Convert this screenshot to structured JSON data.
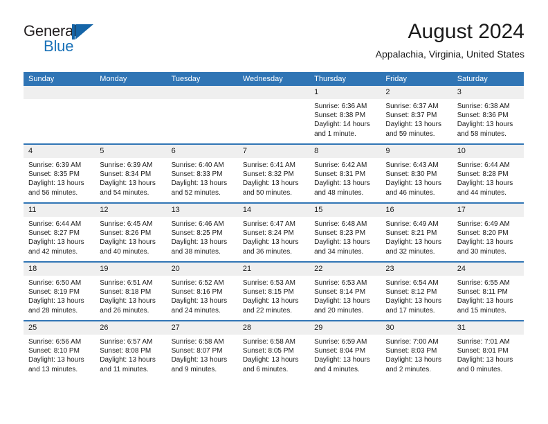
{
  "brand": {
    "word_one": "General",
    "word_two": "Blue",
    "mark": "triangle-logo"
  },
  "header": {
    "title": "August 2024",
    "subtitle": "Appalachia, Virginia, United States"
  },
  "colors": {
    "header_blue": "#3075b5",
    "brand_blue": "#1565a8",
    "daynum_band": "#efefef",
    "text": "#1a1a1a"
  },
  "weekday_headers": [
    "Sunday",
    "Monday",
    "Tuesday",
    "Wednesday",
    "Thursday",
    "Friday",
    "Saturday"
  ],
  "labels": {
    "sunrise": "Sunrise:",
    "sunset": "Sunset:",
    "daylight": "Daylight:"
  },
  "weeks": [
    [
      {
        "day": "",
        "sunrise": "",
        "sunset": "",
        "daylight": "",
        "empty": true
      },
      {
        "day": "",
        "sunrise": "",
        "sunset": "",
        "daylight": "",
        "empty": true
      },
      {
        "day": "",
        "sunrise": "",
        "sunset": "",
        "daylight": "",
        "empty": true
      },
      {
        "day": "",
        "sunrise": "",
        "sunset": "",
        "daylight": "",
        "empty": true
      },
      {
        "day": "1",
        "sunrise": "Sunrise: 6:36 AM",
        "sunset": "Sunset: 8:38 PM",
        "daylight": "Daylight: 14 hours and 1 minute."
      },
      {
        "day": "2",
        "sunrise": "Sunrise: 6:37 AM",
        "sunset": "Sunset: 8:37 PM",
        "daylight": "Daylight: 13 hours and 59 minutes."
      },
      {
        "day": "3",
        "sunrise": "Sunrise: 6:38 AM",
        "sunset": "Sunset: 8:36 PM",
        "daylight": "Daylight: 13 hours and 58 minutes."
      }
    ],
    [
      {
        "day": "4",
        "sunrise": "Sunrise: 6:39 AM",
        "sunset": "Sunset: 8:35 PM",
        "daylight": "Daylight: 13 hours and 56 minutes."
      },
      {
        "day": "5",
        "sunrise": "Sunrise: 6:39 AM",
        "sunset": "Sunset: 8:34 PM",
        "daylight": "Daylight: 13 hours and 54 minutes."
      },
      {
        "day": "6",
        "sunrise": "Sunrise: 6:40 AM",
        "sunset": "Sunset: 8:33 PM",
        "daylight": "Daylight: 13 hours and 52 minutes."
      },
      {
        "day": "7",
        "sunrise": "Sunrise: 6:41 AM",
        "sunset": "Sunset: 8:32 PM",
        "daylight": "Daylight: 13 hours and 50 minutes."
      },
      {
        "day": "8",
        "sunrise": "Sunrise: 6:42 AM",
        "sunset": "Sunset: 8:31 PM",
        "daylight": "Daylight: 13 hours and 48 minutes."
      },
      {
        "day": "9",
        "sunrise": "Sunrise: 6:43 AM",
        "sunset": "Sunset: 8:30 PM",
        "daylight": "Daylight: 13 hours and 46 minutes."
      },
      {
        "day": "10",
        "sunrise": "Sunrise: 6:44 AM",
        "sunset": "Sunset: 8:28 PM",
        "daylight": "Daylight: 13 hours and 44 minutes."
      }
    ],
    [
      {
        "day": "11",
        "sunrise": "Sunrise: 6:44 AM",
        "sunset": "Sunset: 8:27 PM",
        "daylight": "Daylight: 13 hours and 42 minutes."
      },
      {
        "day": "12",
        "sunrise": "Sunrise: 6:45 AM",
        "sunset": "Sunset: 8:26 PM",
        "daylight": "Daylight: 13 hours and 40 minutes."
      },
      {
        "day": "13",
        "sunrise": "Sunrise: 6:46 AM",
        "sunset": "Sunset: 8:25 PM",
        "daylight": "Daylight: 13 hours and 38 minutes."
      },
      {
        "day": "14",
        "sunrise": "Sunrise: 6:47 AM",
        "sunset": "Sunset: 8:24 PM",
        "daylight": "Daylight: 13 hours and 36 minutes."
      },
      {
        "day": "15",
        "sunrise": "Sunrise: 6:48 AM",
        "sunset": "Sunset: 8:23 PM",
        "daylight": "Daylight: 13 hours and 34 minutes."
      },
      {
        "day": "16",
        "sunrise": "Sunrise: 6:49 AM",
        "sunset": "Sunset: 8:21 PM",
        "daylight": "Daylight: 13 hours and 32 minutes."
      },
      {
        "day": "17",
        "sunrise": "Sunrise: 6:49 AM",
        "sunset": "Sunset: 8:20 PM",
        "daylight": "Daylight: 13 hours and 30 minutes."
      }
    ],
    [
      {
        "day": "18",
        "sunrise": "Sunrise: 6:50 AM",
        "sunset": "Sunset: 8:19 PM",
        "daylight": "Daylight: 13 hours and 28 minutes."
      },
      {
        "day": "19",
        "sunrise": "Sunrise: 6:51 AM",
        "sunset": "Sunset: 8:18 PM",
        "daylight": "Daylight: 13 hours and 26 minutes."
      },
      {
        "day": "20",
        "sunrise": "Sunrise: 6:52 AM",
        "sunset": "Sunset: 8:16 PM",
        "daylight": "Daylight: 13 hours and 24 minutes."
      },
      {
        "day": "21",
        "sunrise": "Sunrise: 6:53 AM",
        "sunset": "Sunset: 8:15 PM",
        "daylight": "Daylight: 13 hours and 22 minutes."
      },
      {
        "day": "22",
        "sunrise": "Sunrise: 6:53 AM",
        "sunset": "Sunset: 8:14 PM",
        "daylight": "Daylight: 13 hours and 20 minutes."
      },
      {
        "day": "23",
        "sunrise": "Sunrise: 6:54 AM",
        "sunset": "Sunset: 8:12 PM",
        "daylight": "Daylight: 13 hours and 17 minutes."
      },
      {
        "day": "24",
        "sunrise": "Sunrise: 6:55 AM",
        "sunset": "Sunset: 8:11 PM",
        "daylight": "Daylight: 13 hours and 15 minutes."
      }
    ],
    [
      {
        "day": "25",
        "sunrise": "Sunrise: 6:56 AM",
        "sunset": "Sunset: 8:10 PM",
        "daylight": "Daylight: 13 hours and 13 minutes."
      },
      {
        "day": "26",
        "sunrise": "Sunrise: 6:57 AM",
        "sunset": "Sunset: 8:08 PM",
        "daylight": "Daylight: 13 hours and 11 minutes."
      },
      {
        "day": "27",
        "sunrise": "Sunrise: 6:58 AM",
        "sunset": "Sunset: 8:07 PM",
        "daylight": "Daylight: 13 hours and 9 minutes."
      },
      {
        "day": "28",
        "sunrise": "Sunrise: 6:58 AM",
        "sunset": "Sunset: 8:05 PM",
        "daylight": "Daylight: 13 hours and 6 minutes."
      },
      {
        "day": "29",
        "sunrise": "Sunrise: 6:59 AM",
        "sunset": "Sunset: 8:04 PM",
        "daylight": "Daylight: 13 hours and 4 minutes."
      },
      {
        "day": "30",
        "sunrise": "Sunrise: 7:00 AM",
        "sunset": "Sunset: 8:03 PM",
        "daylight": "Daylight: 13 hours and 2 minutes."
      },
      {
        "day": "31",
        "sunrise": "Sunrise: 7:01 AM",
        "sunset": "Sunset: 8:01 PM",
        "daylight": "Daylight: 13 hours and 0 minutes."
      }
    ]
  ]
}
